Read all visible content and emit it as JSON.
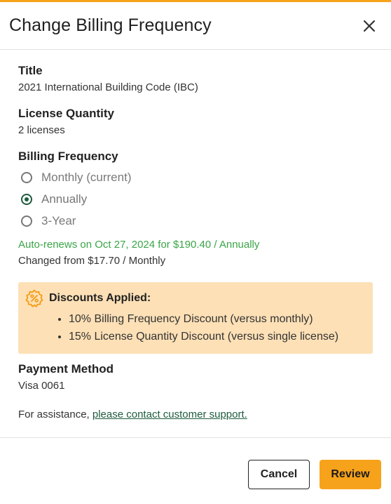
{
  "dialog": {
    "title": "Change Billing Frequency",
    "accent_color": "#f7a21b"
  },
  "title_section": {
    "label": "Title",
    "value": "2021 International Building Code (IBC)"
  },
  "license_section": {
    "label": "License Quantity",
    "value": "2 licenses"
  },
  "billing_section": {
    "label": "Billing Frequency",
    "options": [
      {
        "label": "Monthly (current)",
        "selected": false
      },
      {
        "label": "Annually",
        "selected": true
      },
      {
        "label": "3-Year",
        "selected": false
      }
    ],
    "autorenew_text": "Auto-renews on Oct 27, 2024 for $190.40 / Annually",
    "changed_text": "Changed from $17.70 / Monthly"
  },
  "discounts": {
    "title": "Discounts Applied:",
    "items": [
      "10% Billing Frequency Discount (versus monthly)",
      "15% License Quantity Discount (versus single license)"
    ],
    "icon": "discount-badge-icon",
    "background": "#fde0b6"
  },
  "payment_section": {
    "label": "Payment Method",
    "value": "Visa 0061"
  },
  "assistance": {
    "prefix": "For assistance, ",
    "link_text": "please contact customer support."
  },
  "footer": {
    "cancel_label": "Cancel",
    "review_label": "Review"
  }
}
